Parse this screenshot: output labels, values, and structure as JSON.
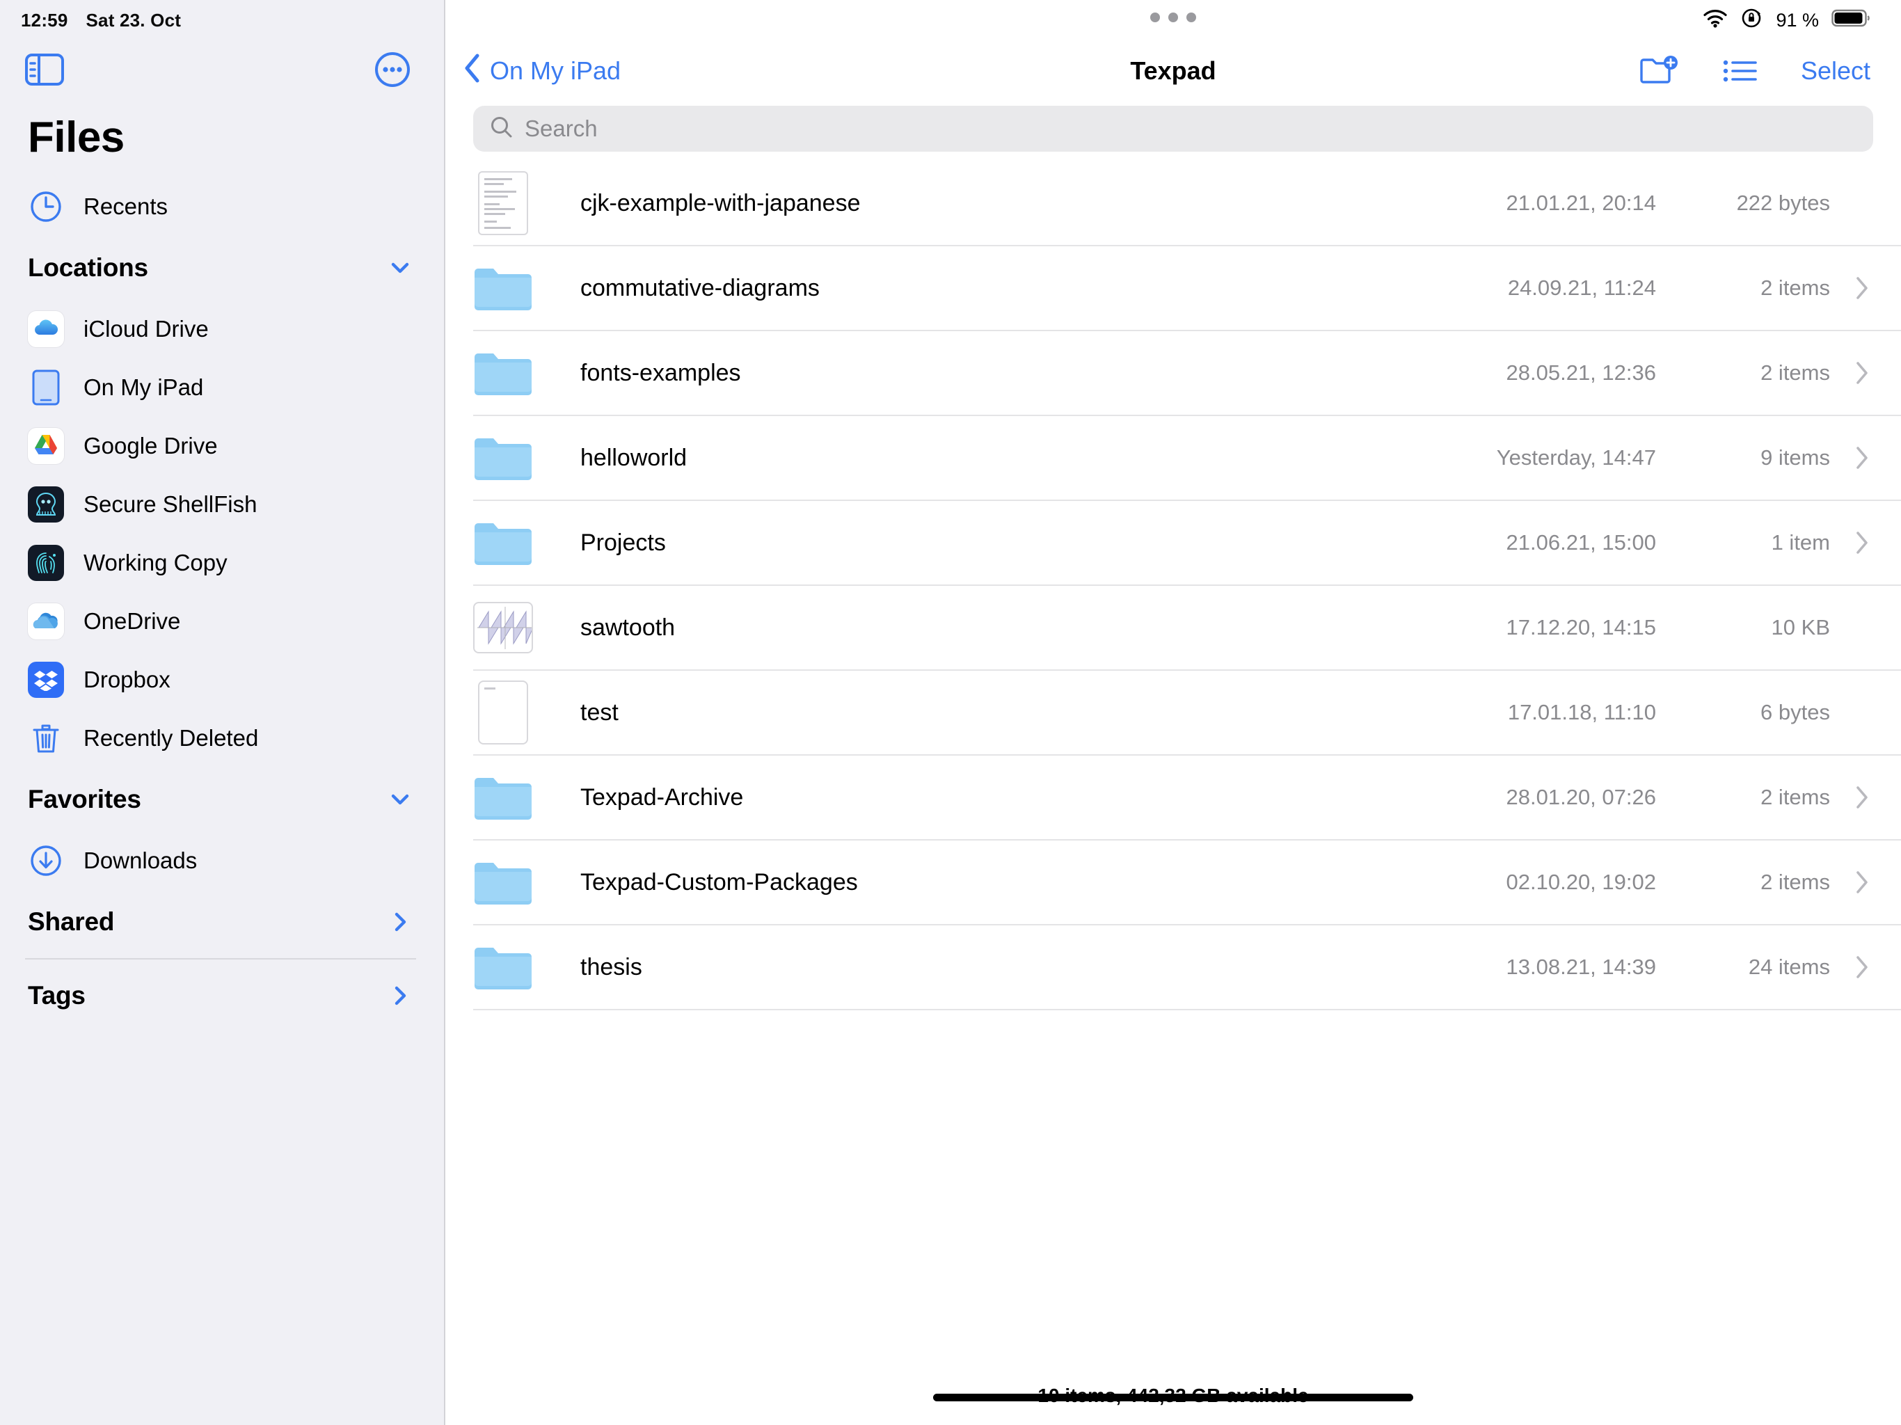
{
  "status_bar": {
    "time": "12:59",
    "date": "Sat 23. Oct",
    "wifi_icon": "wifi-icon",
    "rotation_lock_icon": "rotation-lock-icon",
    "battery_percent": "91 %",
    "battery_icon": "battery-icon"
  },
  "sidebar": {
    "toggle_icon": "sidebar-toggle-icon",
    "more_icon": "more-circle-icon",
    "title": "Files",
    "recents": {
      "label": "Recents",
      "icon": "clock-icon"
    },
    "sections": {
      "locations": {
        "title": "Locations",
        "chevron": "chevron-down-icon"
      },
      "favorites": {
        "title": "Favorites",
        "chevron": "chevron-down-icon"
      },
      "shared": {
        "title": "Shared",
        "chevron": "chevron-right-icon"
      },
      "tags": {
        "title": "Tags",
        "chevron": "chevron-right-icon"
      }
    },
    "locations": [
      {
        "label": "iCloud Drive",
        "icon": "icloud-drive-icon"
      },
      {
        "label": "On My iPad",
        "icon": "ipad-icon"
      },
      {
        "label": "Google Drive",
        "icon": "google-drive-icon"
      },
      {
        "label": "Secure ShellFish",
        "icon": "secure-shellfish-icon"
      },
      {
        "label": "Working Copy",
        "icon": "working-copy-icon"
      },
      {
        "label": "OneDrive",
        "icon": "onedrive-icon"
      },
      {
        "label": "Dropbox",
        "icon": "dropbox-icon"
      },
      {
        "label": "Recently Deleted",
        "icon": "trash-icon"
      }
    ],
    "favorites": [
      {
        "label": "Downloads",
        "icon": "download-circle-icon"
      }
    ]
  },
  "navbar": {
    "back_label": "On My iPad",
    "back_icon": "chevron-left-icon",
    "title": "Texpad",
    "new_folder_icon": "new-folder-icon",
    "view_list_icon": "list-view-icon",
    "select_label": "Select"
  },
  "search": {
    "placeholder": "Search",
    "value": "",
    "icon": "search-icon"
  },
  "files": [
    {
      "name": "cjk-example-with-japanese",
      "date": "21.01.21, 20:14",
      "size": "222 bytes",
      "kind": "document",
      "thumb": "text-document-thumbnail"
    },
    {
      "name": "commutative-diagrams",
      "date": "24.09.21, 11:24",
      "size": "2 items",
      "kind": "folder",
      "thumb": "folder-icon"
    },
    {
      "name": "fonts-examples",
      "date": "28.05.21, 12:36",
      "size": "2 items",
      "kind": "folder",
      "thumb": "folder-icon"
    },
    {
      "name": "helloworld",
      "date": "Yesterday, 14:47",
      "size": "9 items",
      "kind": "folder",
      "thumb": "folder-icon"
    },
    {
      "name": "Projects",
      "date": "21.06.21, 15:00",
      "size": "1 item",
      "kind": "folder",
      "thumb": "folder-icon"
    },
    {
      "name": "sawtooth",
      "date": "17.12.20, 14:15",
      "size": "10 KB",
      "kind": "pdf",
      "thumb": "sawtooth-plot-thumbnail"
    },
    {
      "name": "test",
      "date": "17.01.18, 11:10",
      "size": "6 bytes",
      "kind": "document",
      "thumb": "blank-document-thumbnail"
    },
    {
      "name": "Texpad-Archive",
      "date": "28.01.20, 07:26",
      "size": "2 items",
      "kind": "folder",
      "thumb": "folder-icon"
    },
    {
      "name": "Texpad-Custom-Packages",
      "date": "02.10.20, 19:02",
      "size": "2 items",
      "kind": "folder",
      "thumb": "folder-icon"
    },
    {
      "name": "thesis",
      "date": "13.08.21, 14:39",
      "size": "24 items",
      "kind": "folder",
      "thumb": "folder-icon"
    }
  ],
  "footer": {
    "status": "10 items, 442,32 GB available"
  },
  "colors": {
    "accent": "#3B7BF0",
    "sidebar_bg": "#F0F0F5",
    "folder_blue": "#8ECDF4",
    "secondary_text": "#8A8A8E",
    "search_bg": "#E9E9EB"
  }
}
